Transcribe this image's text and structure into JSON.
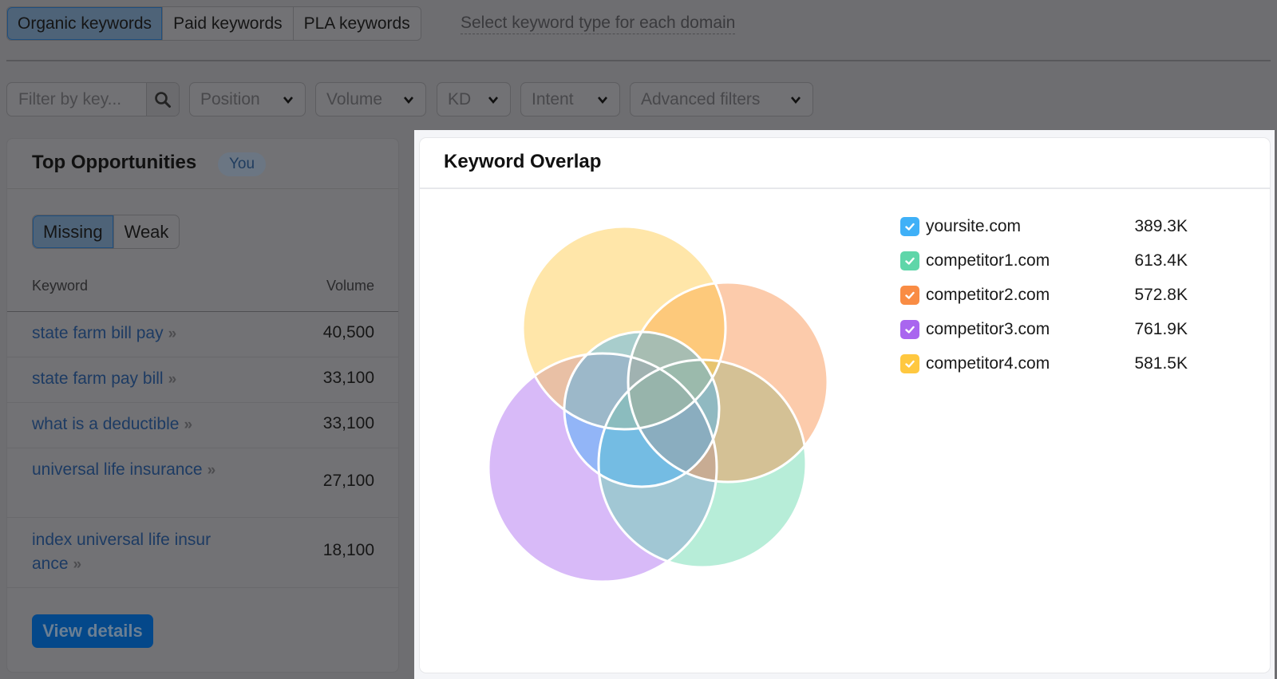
{
  "keyword_tabs": {
    "items": [
      {
        "label": "Organic keywords",
        "active": true
      },
      {
        "label": "Paid keywords",
        "active": false
      },
      {
        "label": "PLA keywords",
        "active": false
      }
    ],
    "hint": "Select keyword type for each domain"
  },
  "filters": {
    "search_placeholder": "Filter by key...",
    "search_value": "",
    "search_icon": "search-icon",
    "dropdowns": [
      {
        "label": "Position",
        "icon": "chevron-down-icon"
      },
      {
        "label": "Volume",
        "icon": "chevron-down-icon"
      },
      {
        "label": "KD",
        "icon": "chevron-down-icon"
      },
      {
        "label": "Intent",
        "icon": "chevron-down-icon"
      },
      {
        "label": "Advanced filters",
        "icon": "chevron-down-icon"
      }
    ]
  },
  "top_opportunities": {
    "title": "Top Opportunities",
    "badge": "You",
    "segments": [
      {
        "label": "Missing",
        "active": true
      },
      {
        "label": "Weak",
        "active": false
      }
    ],
    "columns": {
      "keyword": "Keyword",
      "volume": "Volume"
    },
    "rows": [
      {
        "keyword": "state farm bill pay",
        "volume": "40,500"
      },
      {
        "keyword": "state farm pay bill",
        "volume": "33,100"
      },
      {
        "keyword": "what is a deductible",
        "volume": "33,100"
      },
      {
        "keyword": "universal life insurance",
        "volume": "27,100"
      },
      {
        "keyword": "index universal life insurance",
        "volume": "18,100"
      }
    ],
    "row_arrow": "»",
    "view_details": "View details"
  },
  "keyword_overlap": {
    "title": "Keyword Overlap",
    "domains": [
      {
        "name": "yoursite.com",
        "value": "389.3K",
        "color": "#3fb0f7",
        "fill": "#8f9df0",
        "checked": true
      },
      {
        "name": "competitor1.com",
        "value": "613.4K",
        "color": "#5fd6a9",
        "fill": "#a8ecd6",
        "checked": true
      },
      {
        "name": "competitor2.com",
        "value": "572.8K",
        "color": "#f98c44",
        "fill": "#fcc4a0",
        "checked": true
      },
      {
        "name": "competitor3.com",
        "value": "761.9K",
        "color": "#a966ef",
        "fill": "#d3b6fb",
        "checked": true
      },
      {
        "name": "competitor4.com",
        "value": "581.5K",
        "color": "#ffc840",
        "fill": "#fbe09d",
        "checked": true
      }
    ]
  }
}
